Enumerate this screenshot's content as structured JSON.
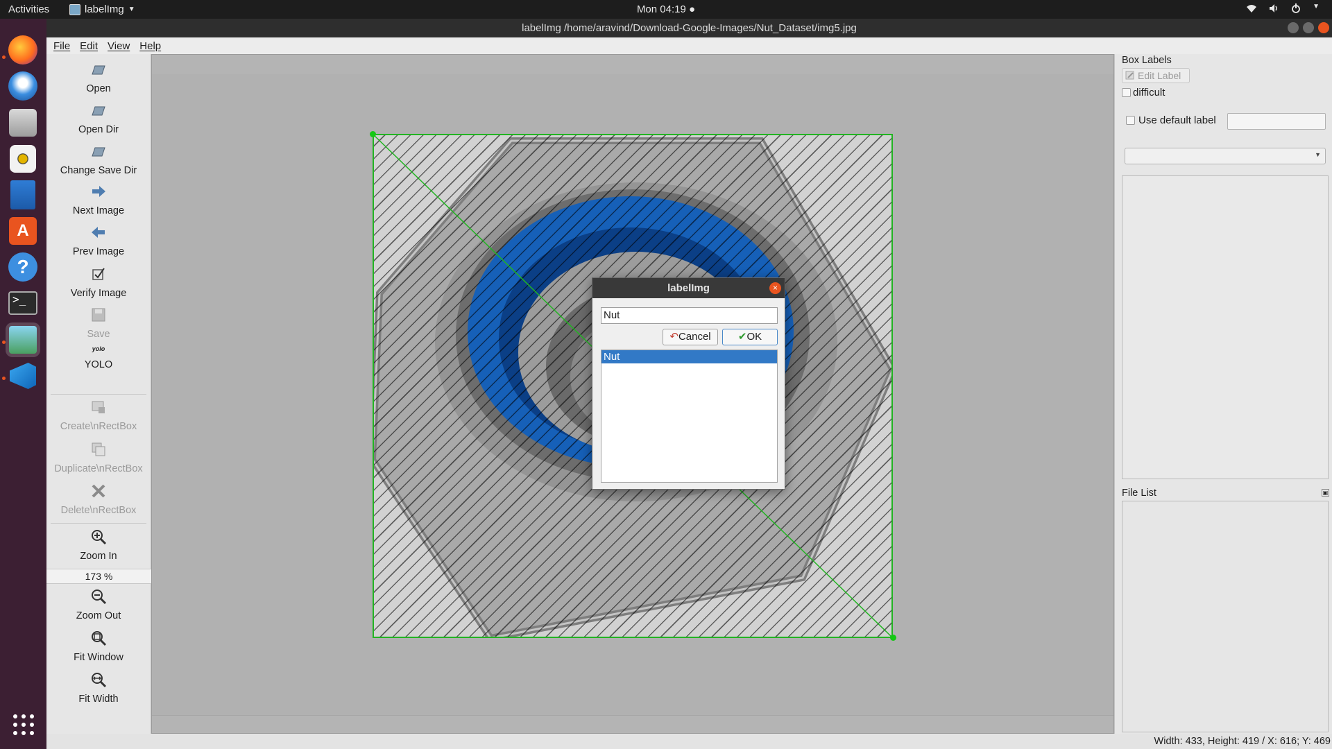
{
  "topbar": {
    "activities": "Activities",
    "app_name": "labelImg",
    "clock": "Mon 04:19",
    "tray_icons": [
      "wifi-icon",
      "volume-icon",
      "power-icon",
      "chevron-down-icon"
    ]
  },
  "dock": {
    "items": [
      "firefox",
      "thunderbird",
      "files",
      "rhythmbox",
      "libreoffice-writer",
      "software-center",
      "help",
      "terminal",
      "labelimg",
      "vscode"
    ],
    "show_apps": "show-applications"
  },
  "window": {
    "title": "labelImg /home/aravind/Download-Google-Images/Nut_Dataset/img5.jpg"
  },
  "menu": {
    "file": "File",
    "edit": "Edit",
    "view": "View",
    "help": "Help"
  },
  "toolbar": {
    "open": "Open",
    "open_dir": "Open Dir",
    "change_save_dir": "Change Save Dir",
    "next_image": "Next Image",
    "prev_image": "Prev Image",
    "verify_image": "Verify Image",
    "save": "Save",
    "yolo_icon_text": "yolo",
    "format": "YOLO",
    "create_rect": "Create\\nRectBox",
    "duplicate_rect": "Duplicate\\nRectBox",
    "delete_rect": "Delete\\nRectBox",
    "zoom_in": "Zoom In",
    "zoom_value": "173 %",
    "zoom_out": "Zoom Out",
    "fit_window": "Fit Window",
    "fit_width": "Fit Width"
  },
  "right_panel": {
    "box_labels_title": "Box Labels",
    "edit_label": "Edit Label",
    "difficult": "difficult",
    "use_default_label": "Use default label",
    "default_label_value": "",
    "file_list_title": "File List"
  },
  "dialog": {
    "title": "labelImg",
    "input_value": "Nut",
    "cancel": "Cancel",
    "ok": "OK",
    "list_items": [
      "Nut"
    ]
  },
  "status": {
    "text": "Width: 433, Height: 419 / X: 616; Y: 469"
  },
  "colors": {
    "accent_orange": "#e9541f",
    "bbox_green": "#22b422",
    "selection_blue": "#3279c6",
    "dock_bg": "#3c1f33"
  }
}
